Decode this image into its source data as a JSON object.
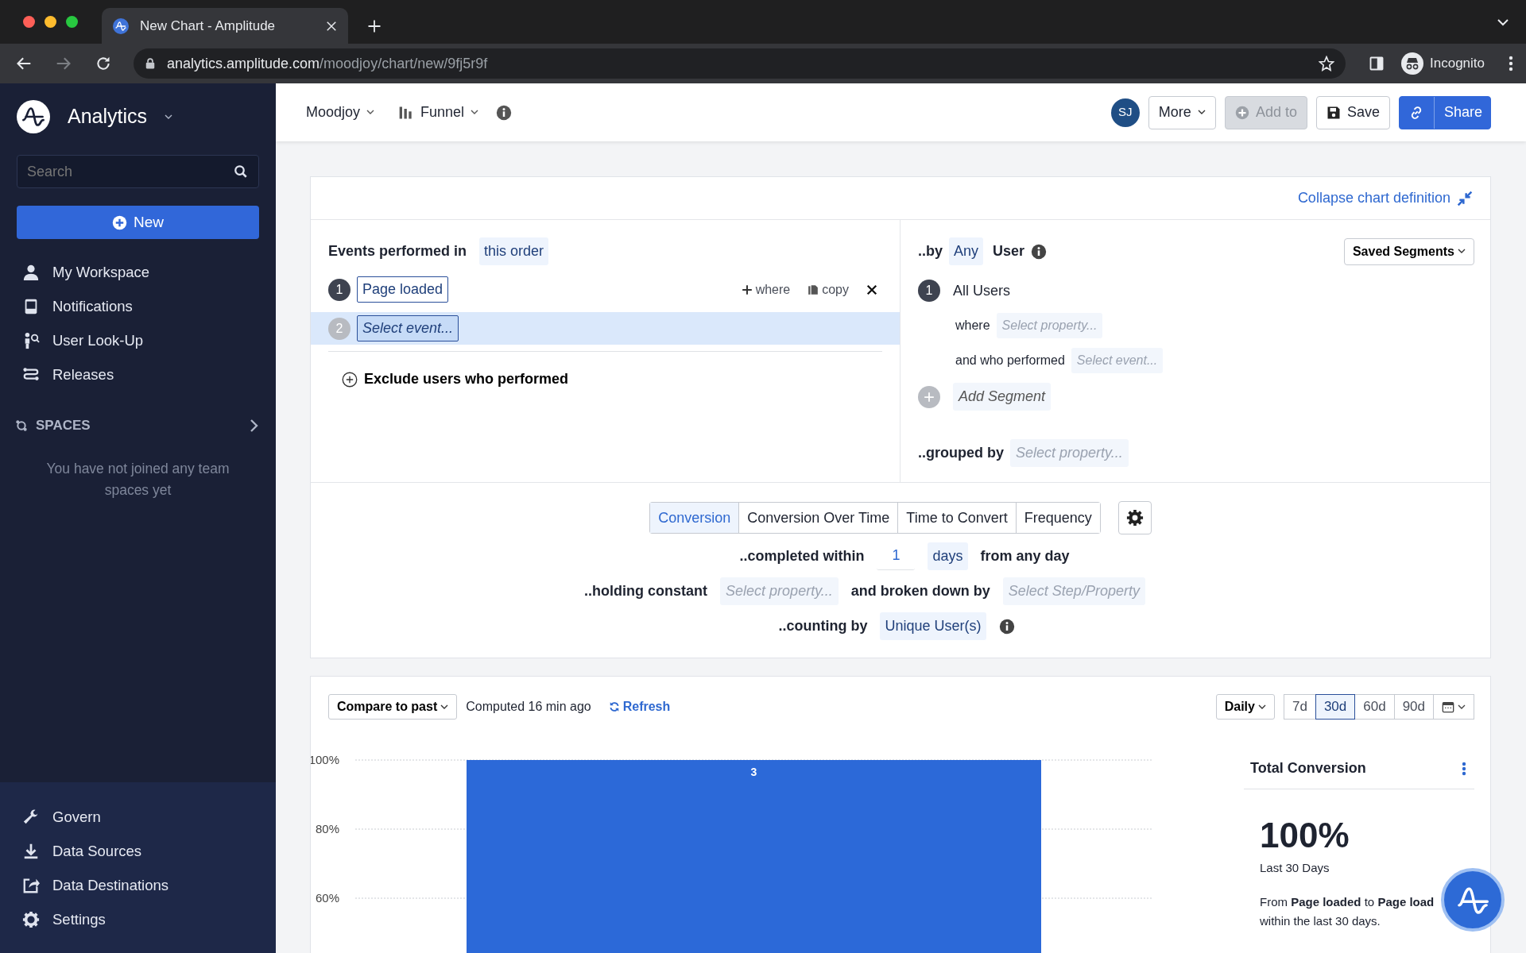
{
  "browser": {
    "tab_title": "New Chart - Amplitude",
    "url_host": "analytics.amplitude.com",
    "url_path": "/moodjoy/chart/new/9fj5r9f",
    "profile": "Incognito"
  },
  "sidebar": {
    "product": "Analytics",
    "search_placeholder": "Search",
    "new_button": "New",
    "items": [
      {
        "label": "My Workspace",
        "kind": "person"
      },
      {
        "label": "Notifications",
        "kind": "inbox"
      },
      {
        "label": "User Look-Up",
        "kind": "lookup"
      },
      {
        "label": "Releases",
        "kind": "releases"
      }
    ],
    "spaces_title": "SPACES",
    "spaces_empty": "You have not joined any team spaces yet",
    "bottom_items": [
      {
        "label": "Govern",
        "kind": "wrench"
      },
      {
        "label": "Data Sources",
        "kind": "download"
      },
      {
        "label": "Data Destinations",
        "kind": "export"
      },
      {
        "label": "Settings",
        "kind": "gear"
      }
    ]
  },
  "header": {
    "project": "Moodjoy",
    "chart_type": "Funnel",
    "avatar": "SJ",
    "buttons": [
      {
        "label": "More",
        "kind": "dropdown",
        "disabled": false
      },
      {
        "label": "Add to",
        "kind": "add",
        "disabled": true
      },
      {
        "label": "Save",
        "kind": "save",
        "disabled": false
      },
      {
        "label": "Share",
        "kind": "share",
        "disabled": false
      }
    ]
  },
  "definition": {
    "collapse_link": "Collapse chart definition",
    "events_label": "Events performed in",
    "order": "this order",
    "steps": [
      {
        "number": "1",
        "label": "Page loaded",
        "placeholder": false,
        "highlighted": false
      },
      {
        "number": "2",
        "label": "Select event...",
        "placeholder": true,
        "highlighted": true
      }
    ],
    "step_actions": [
      "where",
      "copy"
    ],
    "exclude": "Exclude users who performed",
    "segment": {
      "by": "..by",
      "any": "Any",
      "user": "User",
      "saved_segments": "Saved Segments",
      "segments": [
        {
          "number": "1",
          "name": "All Users",
          "where_label": "where",
          "where_placeholder": "Select property...",
          "performed_label": "and who performed",
          "performed_placeholder": "Select event..."
        }
      ],
      "add_segment": "Add Segment",
      "grouped_by": "..grouped by",
      "grouped_placeholder": "Select property..."
    },
    "modes": [
      {
        "label": "Conversion",
        "selected": true
      },
      {
        "label": "Conversion Over Time",
        "selected": false
      },
      {
        "label": "Time to Convert",
        "selected": false
      },
      {
        "label": "Frequency",
        "selected": false
      }
    ],
    "completed_label": "..completed within",
    "completed_value": "1",
    "completed_unit": "days",
    "completed_suffix": "from any day",
    "holding_label": "..holding constant",
    "holding_placeholder": "Select property...",
    "broken_label": "and broken down by",
    "broken_placeholder": "Select Step/Property",
    "counting_label": "..counting by",
    "counting_value": "Unique User(s)"
  },
  "results": {
    "compare": "Compare to past",
    "computed": "Computed 16 min ago",
    "refresh": "Refresh",
    "interval": "Daily",
    "ranges": [
      {
        "label": "7d",
        "selected": false
      },
      {
        "label": "30d",
        "selected": true
      },
      {
        "label": "60d",
        "selected": false
      },
      {
        "label": "90d",
        "selected": false
      }
    ],
    "bar_count": "3",
    "chart_data": {
      "type": "bar",
      "values": [
        100
      ],
      "ylim": [
        0,
        100
      ],
      "yticks": [
        {
          "value": 60,
          "label": "60%"
        },
        {
          "value": 80,
          "label": "80%"
        },
        {
          "value": 100,
          "label": "100%"
        }
      ]
    },
    "summary": {
      "title": "Total Conversion",
      "value": "100%",
      "period": "Last 30 Days",
      "description": "From **Page loaded** to **Page load**",
      "description_2": "within the last 30 days."
    }
  }
}
